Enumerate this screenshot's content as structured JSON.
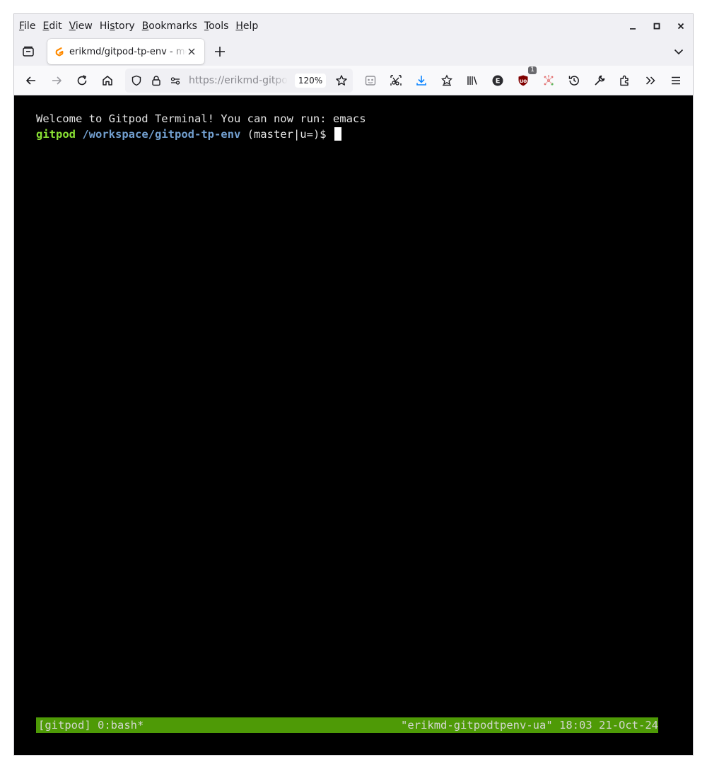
{
  "menubar": {
    "items": [
      {
        "pre": "",
        "mn": "F",
        "post": "ile"
      },
      {
        "pre": "",
        "mn": "E",
        "post": "dit"
      },
      {
        "pre": "",
        "mn": "V",
        "post": "iew"
      },
      {
        "pre": "Hi",
        "mn": "s",
        "post": "tory"
      },
      {
        "pre": "",
        "mn": "B",
        "post": "ookmarks"
      },
      {
        "pre": "",
        "mn": "T",
        "post": "ools"
      },
      {
        "pre": "",
        "mn": "H",
        "post": "elp"
      }
    ]
  },
  "tabs": {
    "active_title": "erikmd/gitpod-tp-env - mozilla",
    "favicon": "gitpod-icon"
  },
  "navbar": {
    "url": "https://erikmd-gitpodtpenv-ua.ws.gitpod.io",
    "zoom": "120%",
    "ublock_badge": "1"
  },
  "terminal": {
    "welcome": "Welcome to Gitpod Terminal! You can now run: emacs",
    "prompt_user": "gitpod",
    "prompt_path": "/workspace/gitpod-tp-env",
    "prompt_git": " (master|u=)$ ",
    "status_left": "[gitpod] 0:bash*",
    "status_right": "\"erikmd-gitpodtpenv-ua\" 18:03 21-Oct-24"
  },
  "colors": {
    "terminal_bg": "#000000",
    "prompt_user": "#8ae234",
    "prompt_path": "#729fcf",
    "status_bg": "#4e9a06"
  }
}
